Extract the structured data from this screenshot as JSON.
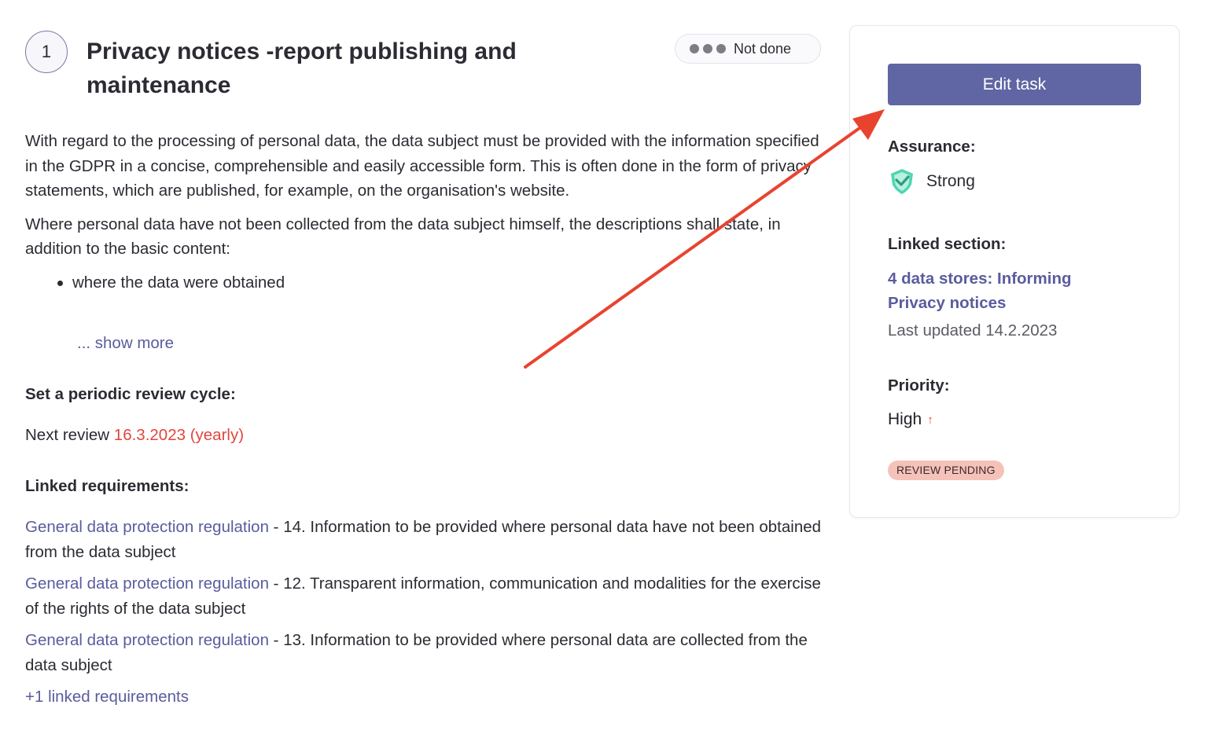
{
  "task": {
    "number": "1",
    "title": "Privacy notices -report publishing and maintenance",
    "status": "Not done"
  },
  "description": {
    "paragraph1": "With regard to the processing of personal data, the data subject must be provided with the information specified in the GDPR in a concise, comprehensible and easily accessible form. This is often done in the form of privacy statements, which are published, for example, on the organisation's website.",
    "paragraph2": "Where personal data have not been collected from the data subject himself, the descriptions shall state, in addition to the basic content:",
    "bullets": [
      "where the data were obtained"
    ],
    "show_more": "... show more"
  },
  "review": {
    "heading": "Set a periodic review cycle:",
    "prefix": "Next review",
    "date": "16.3.2023 (yearly)"
  },
  "requirements": {
    "heading": "Linked requirements:",
    "items": [
      {
        "link": "General data protection regulation",
        "text": " - 14. Information to be provided where personal data have not been obtained from the data subject"
      },
      {
        "link": "General data protection regulation",
        "text": " - 12. Transparent information, communication and modalities for the exercise of the rights of the data subject"
      },
      {
        "link": "General data protection regulation",
        "text": " - 13. Information to be provided where personal data are collected from the data subject"
      }
    ],
    "more": "+1 linked requirements"
  },
  "sidebar": {
    "edit_label": "Edit task",
    "assurance_label": "Assurance:",
    "assurance_value": "Strong",
    "linked_section_label": "Linked section:",
    "linked_section_link": "4 data stores: Informing Privacy notices",
    "last_updated": "Last updated 14.2.2023",
    "priority_label": "Priority:",
    "priority_value": "High",
    "badge": "REVIEW PENDING"
  },
  "colors": {
    "accent": "#6065a3",
    "link": "#5a5c9e",
    "alert": "#e0463f",
    "badge_bg": "#f5c2ba",
    "shield": "#4fd6b2",
    "annotation_arrow": "#e8432f"
  },
  "icons": {
    "assurance": "shield-check-icon",
    "priority": "arrow-up-icon",
    "status": "three-dots-icon"
  }
}
